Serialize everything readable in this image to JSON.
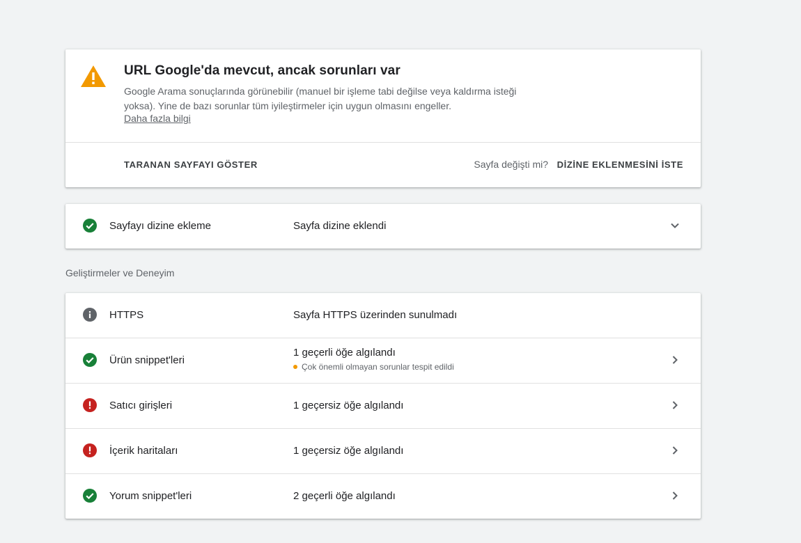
{
  "summary": {
    "title": "URL Google'da mevcut, ancak sorunları var",
    "description": "Google Arama sonuçlarında görünebilir (manuel bir işleme tabi değilse veya kaldırma isteği yoksa). Yine de bazı sorunlar tüm iyileştirmeler için uygun olmasını engeller.",
    "learn_more": "Daha fazla bilgi",
    "view_crawled": "TARANAN SAYFAYI GÖSTER",
    "page_changed": "Sayfa değişti mi?",
    "request_indexing": "DİZİNE EKLENMESİNİ İSTE",
    "warning_color": "#f29900"
  },
  "indexing": {
    "label": "Sayfayı dizine ekleme",
    "status": "Sayfa dizine eklendi",
    "icon": "check-circle-icon"
  },
  "enhancements_heading": "Geliştirmeler ve Deneyim",
  "enhancements": [
    {
      "label": "HTTPS",
      "status": "Sayfa HTTPS üzerinden sunulmadı",
      "icon": "info-icon"
    },
    {
      "label": "Ürün snippet'leri",
      "status": "1 geçerli öğe algılandı",
      "sub": "Çok önemli olmayan sorunlar tespit edildi",
      "icon": "check-circle-icon"
    },
    {
      "label": "Satıcı girişleri",
      "status": "1 geçersiz öğe algılandı",
      "icon": "error-icon"
    },
    {
      "label": "İçerik haritaları",
      "status": "1 geçersiz öğe algılandı",
      "icon": "error-icon"
    },
    {
      "label": "Yorum snippet'leri",
      "status": "2 geçerli öğe algılandı",
      "icon": "check-circle-icon"
    }
  ],
  "colors": {
    "valid": "#188038",
    "error": "#c5221f",
    "info": "#5f6368",
    "minor_issue": "#f29900"
  }
}
